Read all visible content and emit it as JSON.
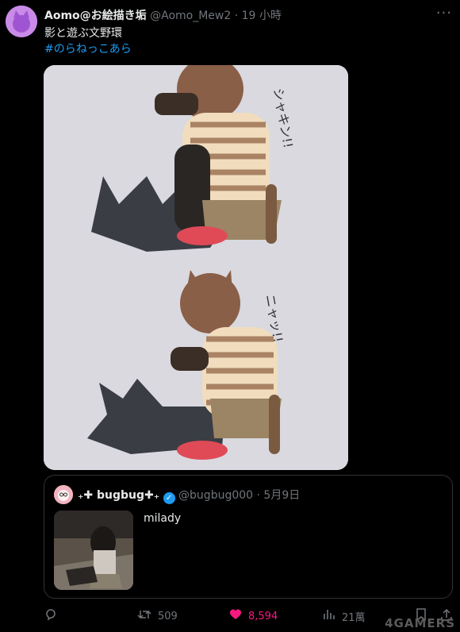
{
  "tweet": {
    "author_name": "Aomo@お絵描き垢",
    "author_handle": "@Aomo_Mew2",
    "separator": "·",
    "time": "19 小時",
    "more_icon": "more-icon",
    "text": "影と遊ぶ文野環",
    "hashtag": "#のらねっこあら",
    "media": {
      "sfx_top": "シャキン!!",
      "sfx_bottom": "ニャッ!!"
    }
  },
  "quote": {
    "author_name": "₊✚ bugbug✚₊",
    "author_handle": "@bugbug000",
    "separator": "·",
    "date": "5月9日",
    "text": "milady"
  },
  "actions": {
    "reply_icon": "reply-icon",
    "retweets": "509",
    "likes": "8,594",
    "views": "21萬",
    "bookmark_icon": "bookmark-icon",
    "share_icon": "share-icon"
  },
  "watermark": "4GAMERS",
  "colors": {
    "background": "#000000",
    "accent": "#1d9bf0",
    "like": "#f91880",
    "muted": "#71767b"
  }
}
